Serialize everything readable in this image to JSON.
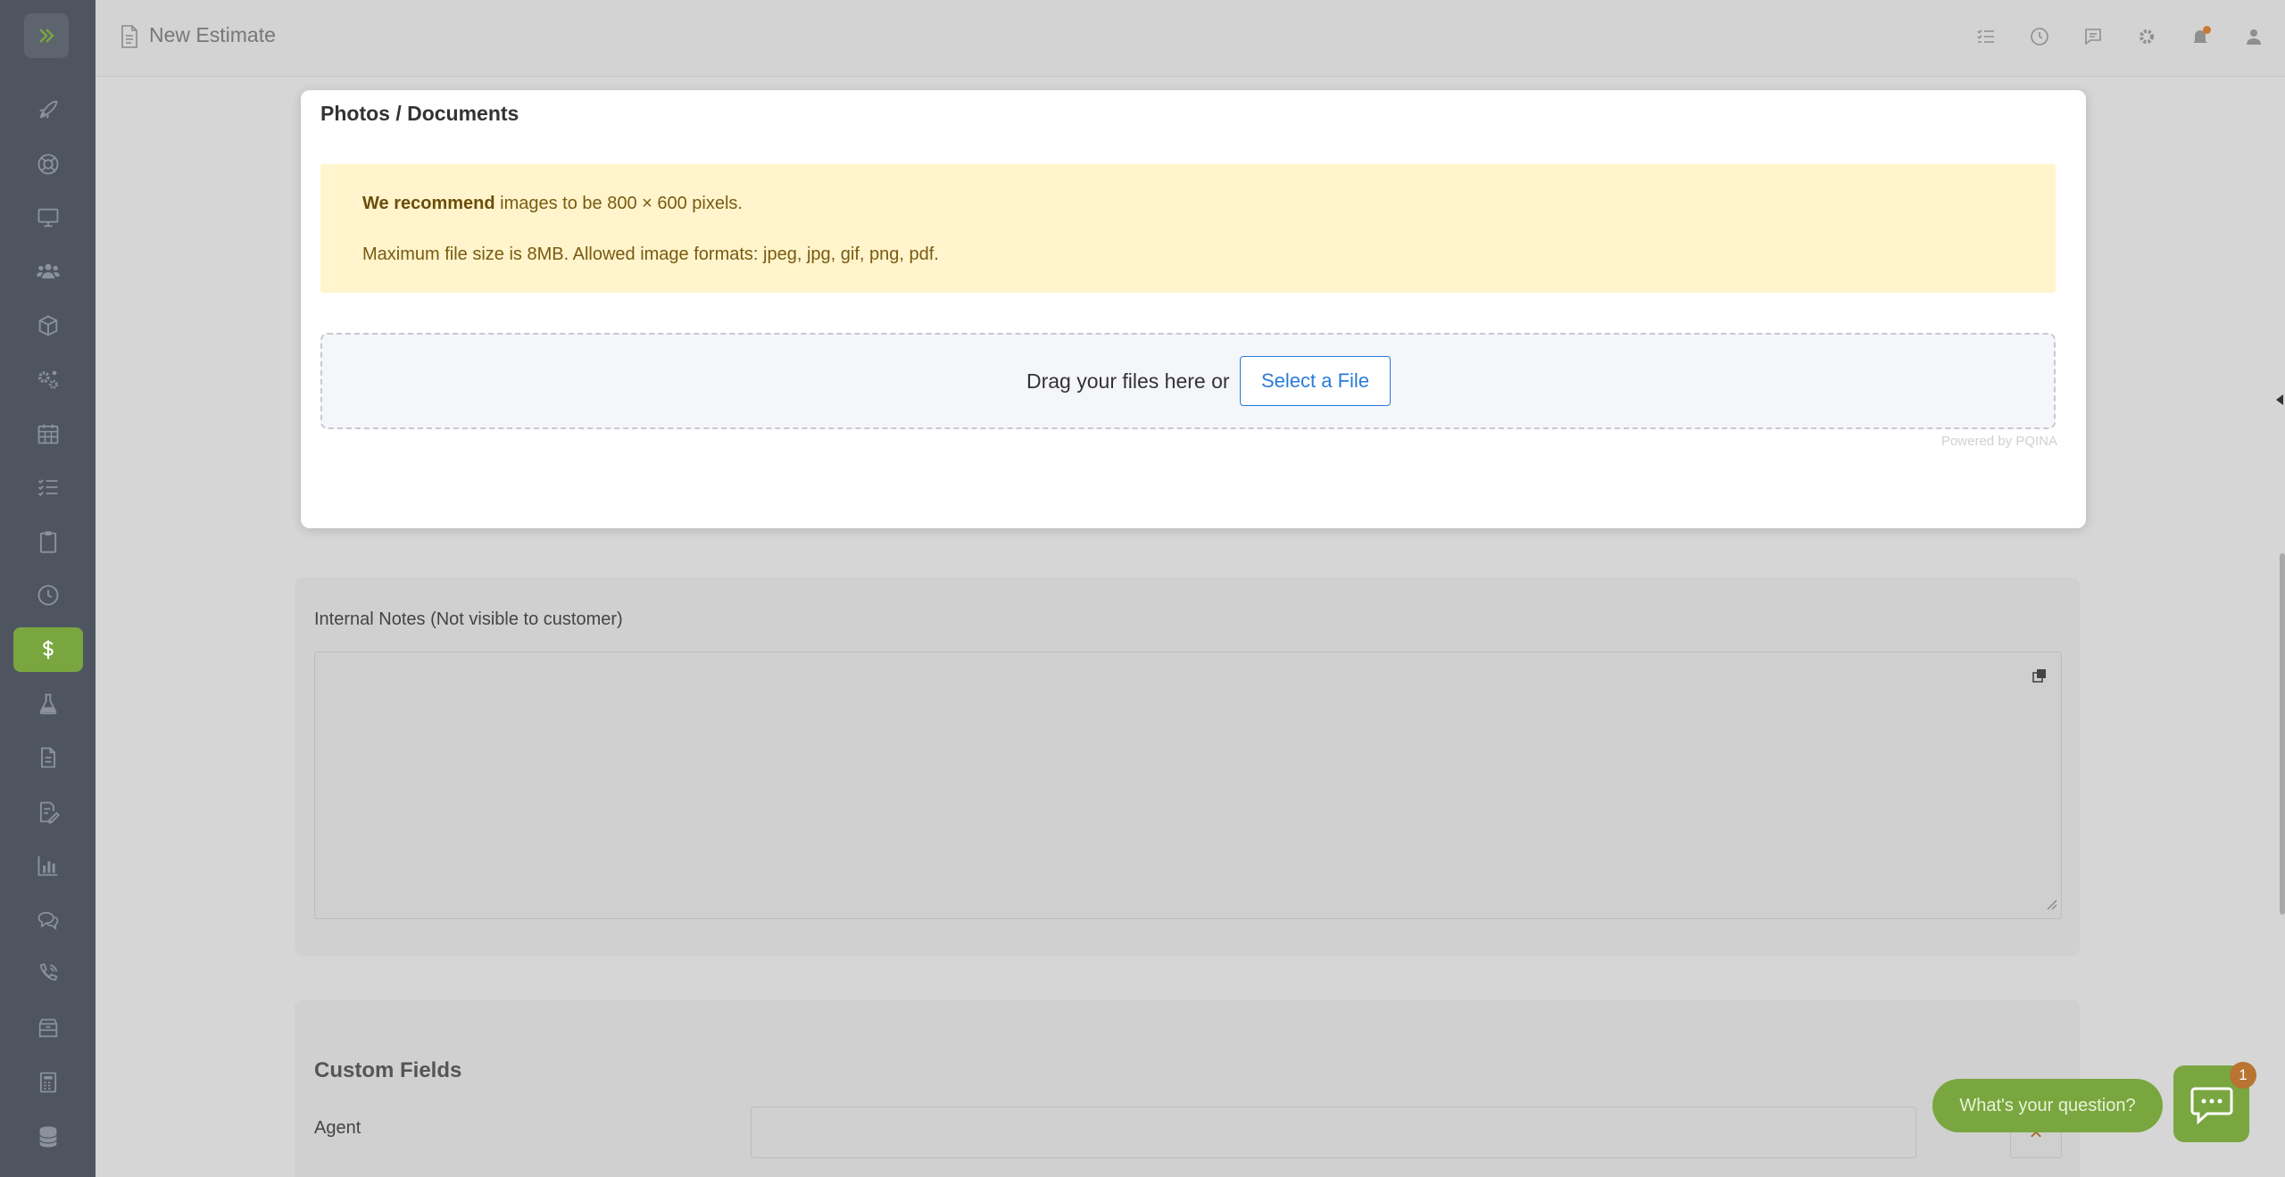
{
  "header": {
    "title": "New Estimate",
    "icons": [
      "tasks-icon",
      "clock-icon",
      "chat-icon",
      "gear-icon",
      "bell-icon",
      "user-icon"
    ]
  },
  "sidebar": {
    "items": [
      {
        "icon": "rocket-icon"
      },
      {
        "icon": "lifebuoy-icon"
      },
      {
        "icon": "monitor-icon"
      },
      {
        "icon": "users-icon"
      },
      {
        "icon": "box-icon"
      },
      {
        "icon": "gears-icon"
      },
      {
        "icon": "calendar-icon"
      },
      {
        "icon": "checklist-icon"
      },
      {
        "icon": "clipboard-icon"
      },
      {
        "icon": "clock-icon"
      },
      {
        "icon": "dollar-icon",
        "active": true
      },
      {
        "icon": "flask-icon"
      },
      {
        "icon": "document-icon"
      },
      {
        "icon": "signature-icon"
      },
      {
        "icon": "bar-chart-icon"
      },
      {
        "icon": "comments-icon"
      },
      {
        "icon": "phone-icon"
      },
      {
        "icon": "archive-icon"
      },
      {
        "icon": "calculator-icon"
      },
      {
        "icon": "database-icon"
      }
    ],
    "active_color": "#7aa640"
  },
  "upload_modal": {
    "title": "Photos / Documents",
    "recommend_bold": "We recommend",
    "recommend_rest": " images to be 800 × 600 pixels.",
    "max_size_text": "Maximum file size is 8MB. Allowed image formats: jpeg, jpg, gif, png, pdf.",
    "drop_text": "Drag your files here or",
    "select_button": "Select a File",
    "powered_by": "Powered by PQINA"
  },
  "notes": {
    "label": "Internal Notes (Not visible to customer)",
    "value": ""
  },
  "custom_fields": {
    "title": "Custom Fields",
    "agent_label": "Agent",
    "agent_value": ""
  },
  "chat": {
    "prompt": "What's your question?",
    "badge_count": "1"
  },
  "colors": {
    "accent": "#7aa640",
    "link_blue": "#2b7bd8",
    "warning_bg": "#fff4cc"
  }
}
